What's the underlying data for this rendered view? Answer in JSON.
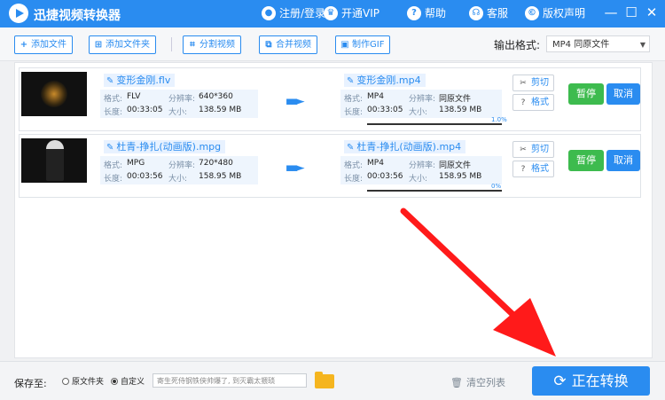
{
  "app": {
    "title": "迅捷视频转换器"
  },
  "titlebar": {
    "items": [
      {
        "label": "注册/登录",
        "icon": "user-icon"
      },
      {
        "label": "开通VIP",
        "icon": "crown-icon"
      },
      {
        "label": "帮助",
        "icon": "help-icon"
      },
      {
        "label": "客服",
        "icon": "headset-icon"
      },
      {
        "label": "版权声明",
        "icon": "copyright-icon"
      }
    ],
    "window": {
      "minimize": "—",
      "maximize": "☐",
      "close": "✕"
    }
  },
  "toolbar": {
    "add_file": "添加文件",
    "add_folder": "添加文件夹",
    "split_video": "分割视频",
    "merge_video": "合并视频",
    "make_gif": "制作GIF",
    "output_format_label": "输出格式:",
    "output_format_value": "MP4  同原文件"
  },
  "files": [
    {
      "source_name": "变形金刚.flv",
      "target_name": "变形金刚.mp4",
      "source": {
        "format_label": "格式:",
        "format": "FLV",
        "resolution_label": "分辨率:",
        "resolution": "640*360",
        "duration_label": "长度:",
        "duration": "00:33:05",
        "size_label": "大小:",
        "size": "138.59 MB"
      },
      "target": {
        "format_label": "格式:",
        "format": "MP4",
        "resolution_label": "分辨率:",
        "resolution": "同原文件",
        "duration_label": "长度:",
        "duration": "00:33:05",
        "size_label": "大小:",
        "size": "138.59 MB"
      },
      "progress_text": "1.0%",
      "progress": 1.0,
      "clip_label": "剪切",
      "format_button_label": "格式",
      "pause_label": "暂停",
      "cancel_label": "取消"
    },
    {
      "source_name": "杜青-挣扎(动画版).mpg",
      "target_name": "杜青-挣扎(动画版).mp4",
      "source": {
        "format_label": "格式:",
        "format": "MPG",
        "resolution_label": "分辨率:",
        "resolution": "720*480",
        "duration_label": "长度:",
        "duration": "00:03:56",
        "size_label": "大小:",
        "size": "158.95 MB"
      },
      "target": {
        "format_label": "格式:",
        "format": "MP4",
        "resolution_label": "分辨率:",
        "resolution": "同原文件",
        "duration_label": "长度:",
        "duration": "00:03:56",
        "size_label": "大小:",
        "size": "158.95 MB"
      },
      "progress_text": "0%",
      "progress": 0,
      "clip_label": "剪切",
      "format_button_label": "格式",
      "pause_label": "暂停",
      "cancel_label": "取消"
    }
  ],
  "bottom": {
    "save_to_label": "保存至:",
    "option_original": "原文件夹",
    "option_custom": "自定义",
    "custom_selected": true,
    "path_value": "寄生死侍钢铁侠帅爆了, 到灭霸太猥琐",
    "clear_list": "清空列表",
    "convert_button": "正在转换"
  },
  "colors": {
    "primary": "#2a8cf0",
    "pause": "#3dbb4e",
    "annotation_arrow": "#ff1a1a"
  }
}
